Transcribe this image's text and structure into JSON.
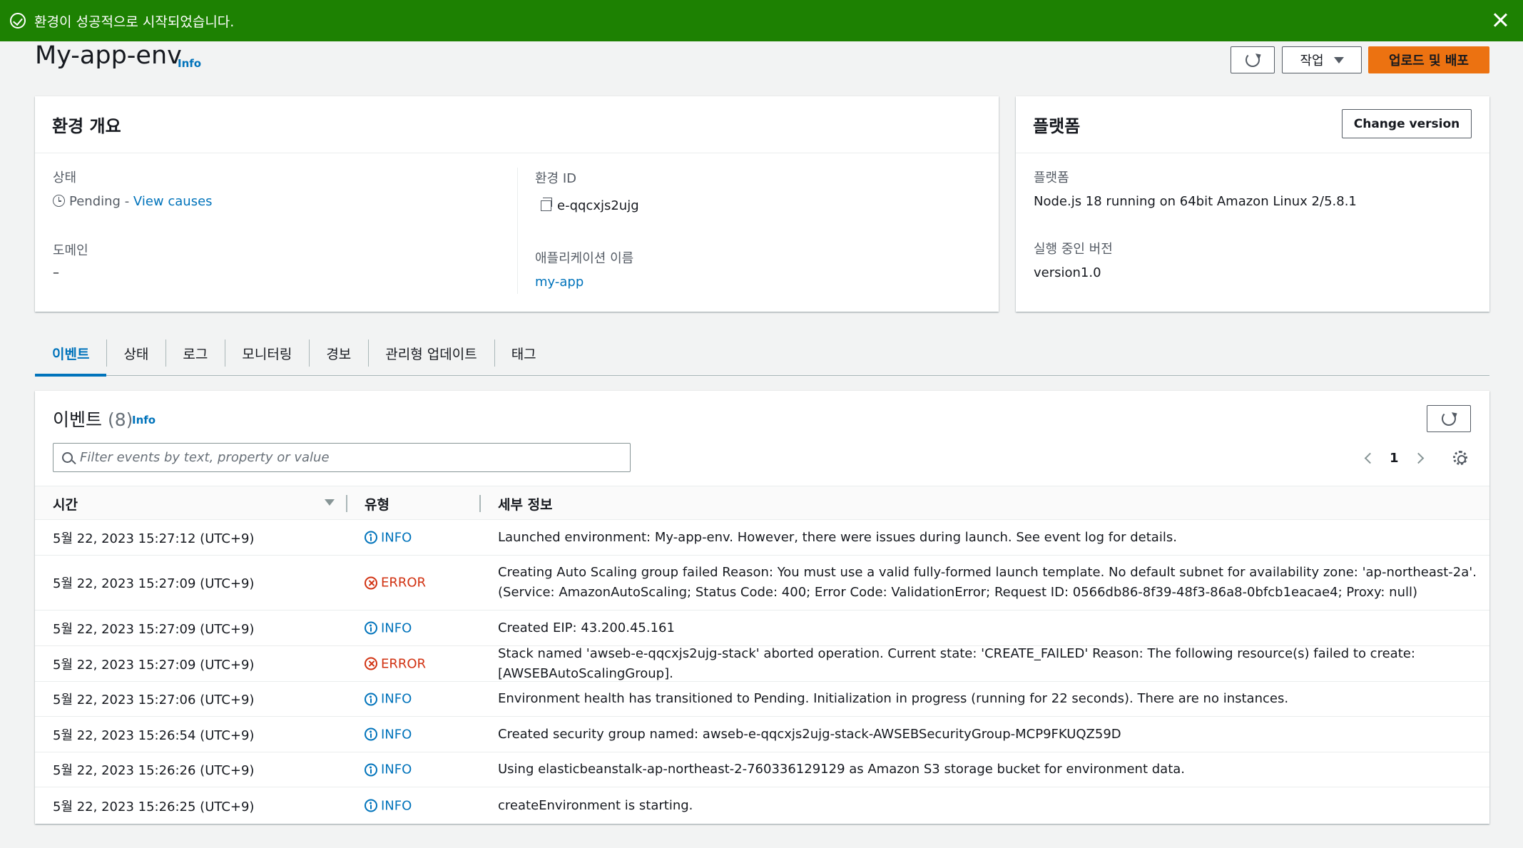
{
  "flash": {
    "message": "환경이 성공적으로 시작되었습니다."
  },
  "header": {
    "title": "My-app-env",
    "info": "Info",
    "actions_label": "작업",
    "deploy_label": "업로드 및 배포"
  },
  "overview": {
    "title": "환경 개요",
    "status_label": "상태",
    "status_value": "Pending",
    "status_sep": " - ",
    "status_link": "View causes",
    "domain_label": "도메인",
    "domain_value": "–",
    "env_id_label": "환경 ID",
    "env_id_value": "e-qqcxjs2ujg",
    "app_name_label": "애플리케이션 이름",
    "app_name_value": "my-app"
  },
  "platform": {
    "title": "플랫폼",
    "change_version_label": "Change version",
    "platform_label": "플랫폼",
    "platform_value": "Node.js 18 running on 64bit Amazon Linux 2/5.8.1",
    "running_version_label": "실행 중인 버전",
    "running_version_value": "version1.0"
  },
  "tabs": [
    {
      "label": "이벤트",
      "active": true
    },
    {
      "label": "상태"
    },
    {
      "label": "로그"
    },
    {
      "label": "모니터링"
    },
    {
      "label": "경보"
    },
    {
      "label": "관리형 업데이트"
    },
    {
      "label": "태그"
    }
  ],
  "events": {
    "title": "이벤트",
    "count": "(8)",
    "info": "Info",
    "search_placeholder": "Filter events by text, property or value",
    "page": "1",
    "columns": {
      "time": "시간",
      "type": "유형",
      "detail": "세부 정보"
    },
    "rows": [
      {
        "time": "5월 22, 2023 15:27:12 (UTC+9)",
        "type": "INFO",
        "detail": "Launched environment: My-app-env. However, there were issues during launch. See event log for details."
      },
      {
        "time": "5월 22, 2023 15:27:09 (UTC+9)",
        "type": "ERROR",
        "detail": "Creating Auto Scaling group failed Reason: You must use a valid fully-formed launch template. No default subnet for availability zone: 'ap-northeast-2a'. (Service: AmazonAutoScaling; Status Code: 400; Error Code: ValidationError; Request ID: 0566db86-8f39-48f3-86a8-0bfcb1eacae4; Proxy: null)"
      },
      {
        "time": "5월 22, 2023 15:27:09 (UTC+9)",
        "type": "INFO",
        "detail": "Created EIP: 43.200.45.161"
      },
      {
        "time": "5월 22, 2023 15:27:09 (UTC+9)",
        "type": "ERROR",
        "detail": "Stack named 'awseb-e-qqcxjs2ujg-stack' aborted operation. Current state: 'CREATE_FAILED' Reason: The following resource(s) failed to create: [AWSEBAutoScalingGroup]."
      },
      {
        "time": "5월 22, 2023 15:27:06 (UTC+9)",
        "type": "INFO",
        "detail": "Environment health has transitioned to Pending. Initialization in progress (running for 22 seconds). There are no instances."
      },
      {
        "time": "5월 22, 2023 15:26:54 (UTC+9)",
        "type": "INFO",
        "detail": "Created security group named: awseb-e-qqcxjs2ujg-stack-AWSEBSecurityGroup-MCP9FKUQZ59D"
      },
      {
        "time": "5월 22, 2023 15:26:26 (UTC+9)",
        "type": "INFO",
        "detail": "Using elasticbeanstalk-ap-northeast-2-760336129129 as Amazon S3 storage bucket for environment data."
      },
      {
        "time": "5월 22, 2023 15:26:25 (UTC+9)",
        "type": "INFO",
        "detail": "createEnvironment is starting."
      }
    ]
  },
  "colors": {
    "success": "#1d8102",
    "primary": "#ec7211",
    "link": "#0073bb",
    "error": "#d13212"
  }
}
